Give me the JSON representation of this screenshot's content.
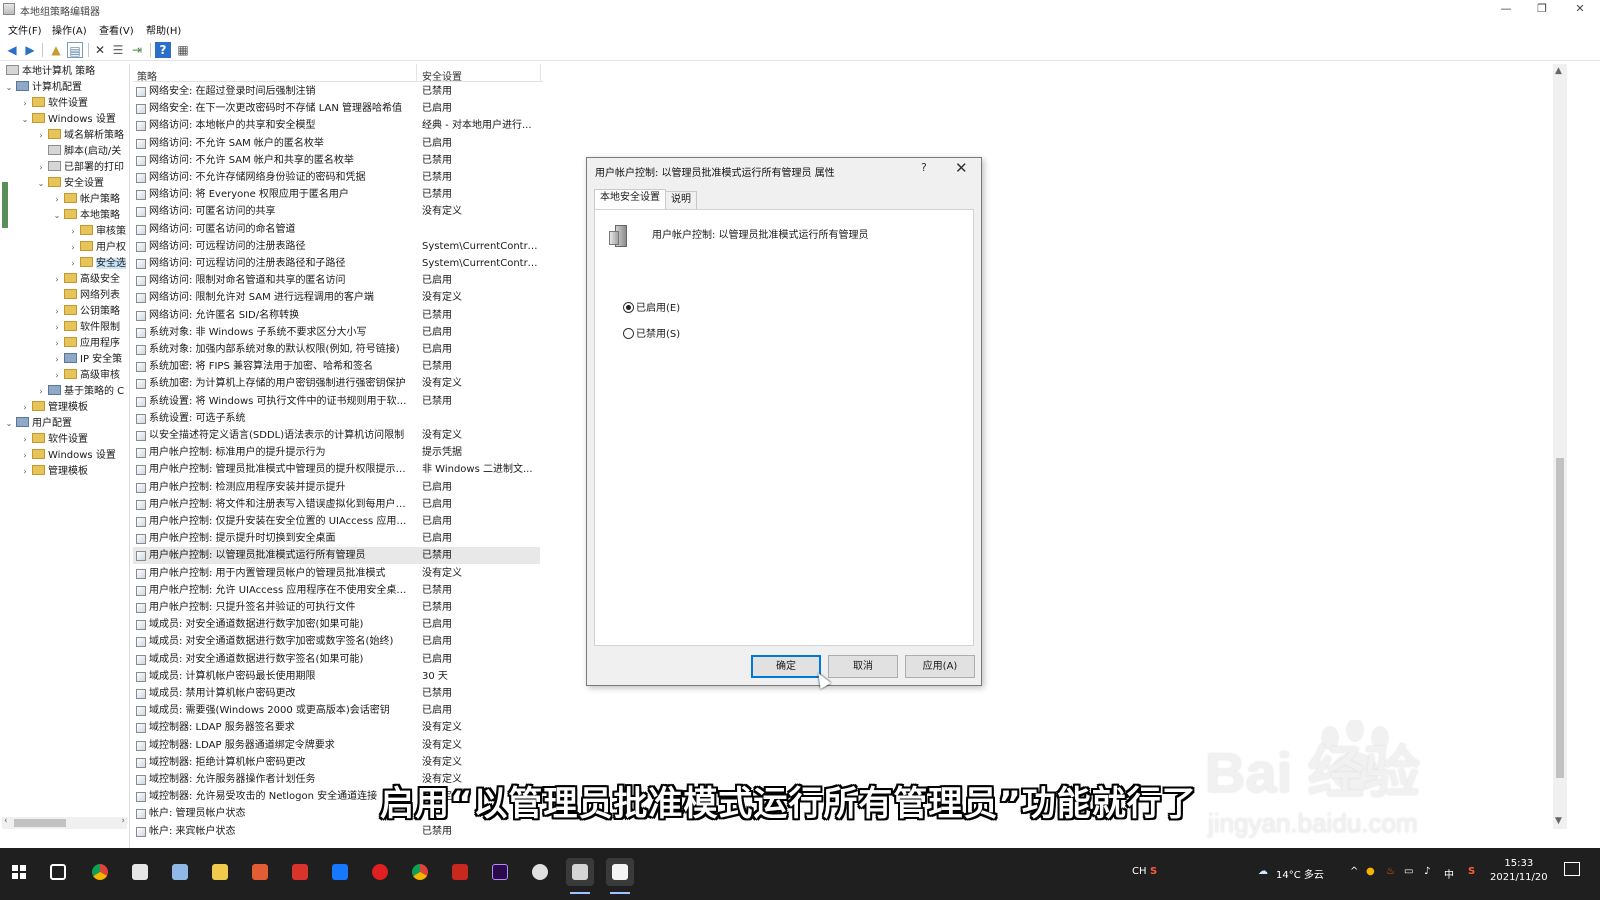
{
  "window": {
    "title": "本地组策略编辑器",
    "minimize": "—",
    "restore": "❐",
    "close": "✕"
  },
  "menubar": [
    "文件(F)",
    "操作(A)",
    "查看(V)",
    "帮助(H)"
  ],
  "tree": {
    "root": "本地计算机 策略",
    "computer_config": "计算机配置",
    "software_settings": "软件设置",
    "windows_settings": "Windows 设置",
    "dns_policy": "域名解析策略",
    "scripts": "脚本(启动/关",
    "deployed_printers": "已部署的打印",
    "security_settings": "安全设置",
    "account_policies": "帐户策略",
    "local_policies": "本地策略",
    "audit": "审核策",
    "user_rights": "用户权",
    "security_options": "安全选",
    "advanced_security": "高级安全",
    "network_list": "网络列表",
    "public_key": "公钥策略",
    "software_restriction": "软件限制",
    "app_control": "应用程序",
    "ip_security": "IP 安全策",
    "advanced_audit": "高级审核",
    "qos": "基于策略的 C",
    "admin_templates": "管理模板",
    "user_config": "用户配置",
    "user_software": "软件设置",
    "user_windows": "Windows 设置",
    "user_templates": "管理模板"
  },
  "list": {
    "col_policy": "策略",
    "col_setting": "安全设置",
    "rows": [
      {
        "name": "网络安全: 在超过登录时间后强制注销",
        "value": "已禁用"
      },
      {
        "name": "网络安全: 在下一次更改密码时不存储 LAN 管理器哈希值",
        "value": "已启用"
      },
      {
        "name": "网络访问: 本地帐户的共享和安全模型",
        "value": "经典 - 对本地用户进行..."
      },
      {
        "name": "网络访问: 不允许 SAM 帐户的匿名枚举",
        "value": "已启用"
      },
      {
        "name": "网络访问: 不允许 SAM 帐户和共享的匿名枚举",
        "value": "已禁用"
      },
      {
        "name": "网络访问: 不允许存储网络身份验证的密码和凭据",
        "value": "已禁用"
      },
      {
        "name": "网络访问: 将 Everyone 权限应用于匿名用户",
        "value": "已禁用"
      },
      {
        "name": "网络访问: 可匿名访问的共享",
        "value": "没有定义"
      },
      {
        "name": "网络访问: 可匿名访问的命名管道",
        "value": ""
      },
      {
        "name": "网络访问: 可远程访问的注册表路径",
        "value": "System\\CurrentContro..."
      },
      {
        "name": "网络访问: 可远程访问的注册表路径和子路径",
        "value": "System\\CurrentContro..."
      },
      {
        "name": "网络访问: 限制对命名管道和共享的匿名访问",
        "value": "已启用"
      },
      {
        "name": "网络访问: 限制允许对 SAM 进行远程调用的客户端",
        "value": "没有定义"
      },
      {
        "name": "网络访问: 允许匿名 SID/名称转换",
        "value": "已禁用"
      },
      {
        "name": "系统对象: 非 Windows 子系统不要求区分大小写",
        "value": "已启用"
      },
      {
        "name": "系统对象: 加强内部系统对象的默认权限(例如, 符号链接)",
        "value": "已启用"
      },
      {
        "name": "系统加密: 将 FIPS 兼容算法用于加密、哈希和签名",
        "value": "已禁用"
      },
      {
        "name": "系统加密: 为计算机上存储的用户密钥强制进行强密钥保护",
        "value": "没有定义"
      },
      {
        "name": "系统设置: 将 Windows 可执行文件中的证书规则用于软件...",
        "value": "已禁用"
      },
      {
        "name": "系统设置: 可选子系统",
        "value": ""
      },
      {
        "name": "以安全描述符定义语言(SDDL)语法表示的计算机访问限制",
        "value": "没有定义"
      },
      {
        "name": "用户帐户控制: 标准用户的提升提示行为",
        "value": "提示凭据"
      },
      {
        "name": "用户帐户控制: 管理员批准模式中管理员的提升权限提示的...",
        "value": "非 Windows 二进制文..."
      },
      {
        "name": "用户帐户控制: 检测应用程序安装并提示提升",
        "value": "已启用"
      },
      {
        "name": "用户帐户控制: 将文件和注册表写入错误虚拟化到每用户位置",
        "value": "已启用"
      },
      {
        "name": "用户帐户控制: 仅提升安装在安全位置的 UIAccess 应用程序",
        "value": "已启用"
      },
      {
        "name": "用户帐户控制: 提示提升时切换到安全桌面",
        "value": "已启用"
      },
      {
        "name": "用户帐户控制: 以管理员批准模式运行所有管理员",
        "value": "已禁用"
      },
      {
        "name": "用户帐户控制: 用于内置管理员帐户的管理员批准模式",
        "value": "没有定义"
      },
      {
        "name": "用户帐户控制: 允许 UIAccess 应用程序在不使用安全桌面...",
        "value": "已禁用"
      },
      {
        "name": "用户帐户控制: 只提升签名并验证的可执行文件",
        "value": "已禁用"
      },
      {
        "name": "域成员: 对安全通道数据进行数字加密(如果可能)",
        "value": "已启用"
      },
      {
        "name": "域成员: 对安全通道数据进行数字加密或数字签名(始终)",
        "value": "已启用"
      },
      {
        "name": "域成员: 对安全通道数据进行数字签名(如果可能)",
        "value": "已启用"
      },
      {
        "name": "域成员: 计算机帐户密码最长使用期限",
        "value": "30 天"
      },
      {
        "name": "域成员: 禁用计算机帐户密码更改",
        "value": "已禁用"
      },
      {
        "name": "域成员: 需要强(Windows 2000 或更高版本)会话密钥",
        "value": "已启用"
      },
      {
        "name": "域控制器: LDAP 服务器签名要求",
        "value": "没有定义"
      },
      {
        "name": "域控制器: LDAP 服务器通道绑定令牌要求",
        "value": "没有定义"
      },
      {
        "name": "域控制器: 拒绝计算机帐户密码更改",
        "value": "没有定义"
      },
      {
        "name": "域控制器: 允许服务器操作者计划任务",
        "value": "没有定义"
      },
      {
        "name": "域控制器: 允许易受攻击的 Netlogon 安全通道连接",
        "value": "没有定义"
      },
      {
        "name": "帐户: 管理员帐户状态",
        "value": ""
      },
      {
        "name": "帐户: 来宾帐户状态",
        "value": "已禁用"
      }
    ]
  },
  "dialog": {
    "title": "用户帐户控制: 以管理员批准模式运行所有管理员 属性",
    "help": "?",
    "close": "✕",
    "tab_local": "本地安全设置",
    "tab_explain": "说明",
    "policy_name": "用户帐户控制: 以管理员批准模式运行所有管理员",
    "radio_enabled": "已启用(E)",
    "radio_disabled": "已禁用(S)",
    "btn_ok": "确定",
    "btn_cancel": "取消",
    "btn_apply": "应用(A)"
  },
  "subtitle": "启用“以管理员批准模式运行所有管理员”功能就行了",
  "watermark": {
    "main": "Bai 经验",
    "sub": "jingyan.baidu.com"
  },
  "taskbar": {
    "weather": "14°C 多云",
    "tray_ime": "中",
    "tray_ch": "CH",
    "time": "15:33",
    "date": "2021/11/20"
  }
}
